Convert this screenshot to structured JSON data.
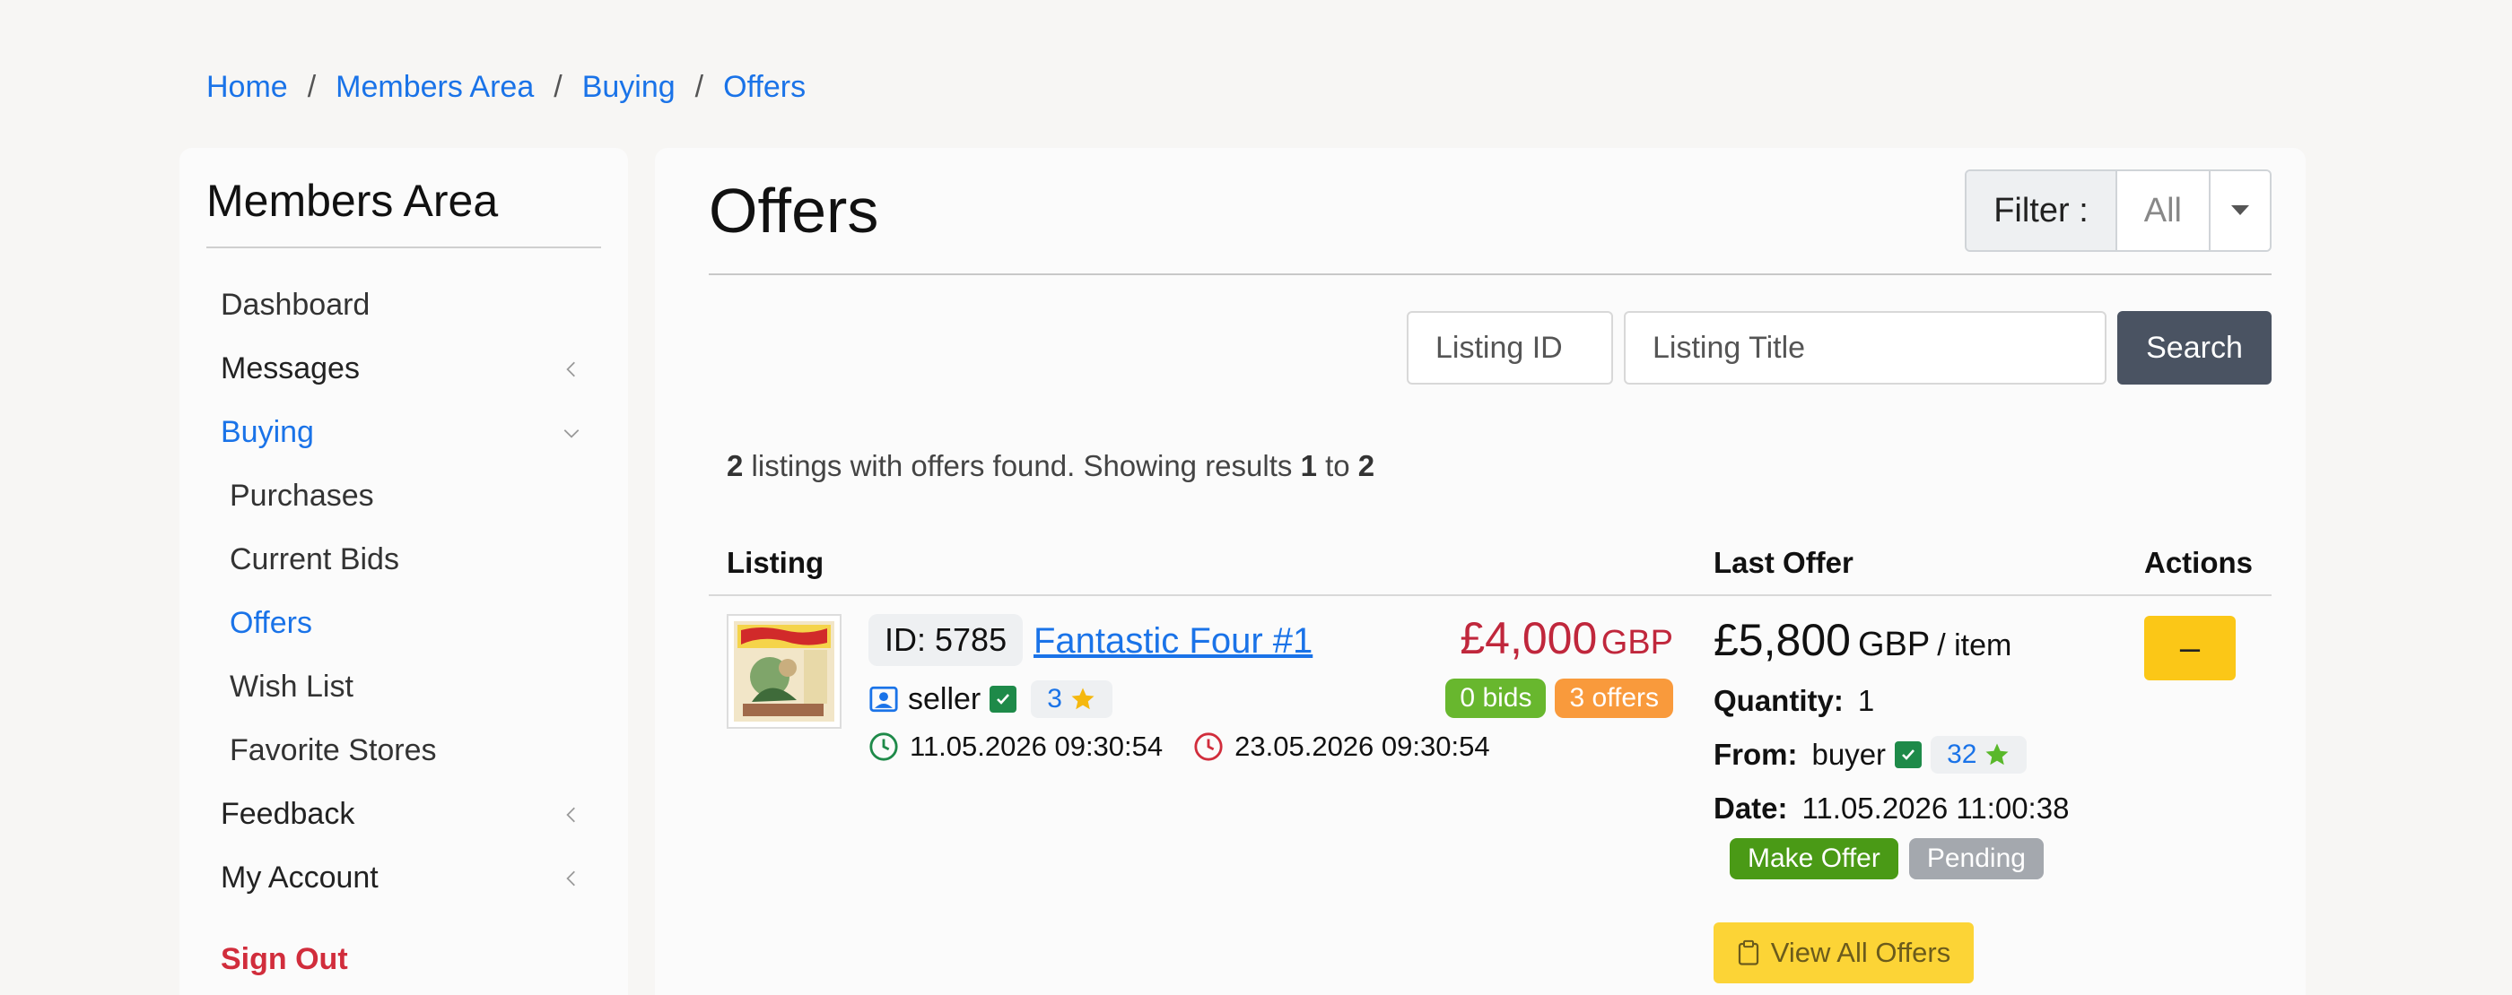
{
  "breadcrumb": [
    "Home",
    "Members Area",
    "Buying",
    "Offers"
  ],
  "sidebar": {
    "title": "Members Area",
    "items": [
      {
        "label": "Dashboard"
      },
      {
        "label": "Messages"
      },
      {
        "label": "Buying"
      },
      {
        "label": "Purchases"
      },
      {
        "label": "Current Bids"
      },
      {
        "label": "Offers"
      },
      {
        "label": "Wish List"
      },
      {
        "label": "Favorite Stores"
      },
      {
        "label": "Feedback"
      },
      {
        "label": "My Account"
      },
      {
        "label": "Sign Out"
      }
    ]
  },
  "main": {
    "title": "Offers",
    "filter_label": "Filter :",
    "filter_value": "All",
    "search": {
      "id_placeholder": "Listing ID",
      "title_placeholder": "Listing Title",
      "button": "Search"
    },
    "results": {
      "count": "2",
      "text1": " listings with offers found. Showing results ",
      "from": "1",
      "text2": " to ",
      "to": "2"
    },
    "table": {
      "headers": [
        "Listing",
        "Last Offer",
        "Actions"
      ]
    },
    "row": {
      "id": "ID: 5785",
      "title": "Fantastic Four #1",
      "price_amount": "£4,000",
      "price_currency": "GBP",
      "seller": "seller",
      "seller_rating": "3",
      "bids": "0 bids",
      "offers": "3 offers",
      "start_date": "11.05.2026 09:30:54",
      "end_date": "23.05.2026 09:30:54",
      "offer_amount": "£5,800",
      "offer_currency": "GBP",
      "offer_per": "/ item",
      "quantity_label": "Quantity:",
      "quantity": "1",
      "from_label": "From:",
      "buyer": "buyer",
      "buyer_rating": "32",
      "date_label": "Date:",
      "offer_date": "11.05.2026 11:00:38",
      "tag_make_offer": "Make Offer",
      "tag_pending": "Pending",
      "view_all": "View All Offers",
      "action_symbol": "–"
    }
  },
  "colors": {
    "link": "#1a73e8",
    "price": "#c0273c",
    "bids_green": "#68b72e",
    "offers_orange": "#f99a3c",
    "action_yellow": "#fbc717",
    "signout_red": "#d12d3c"
  }
}
